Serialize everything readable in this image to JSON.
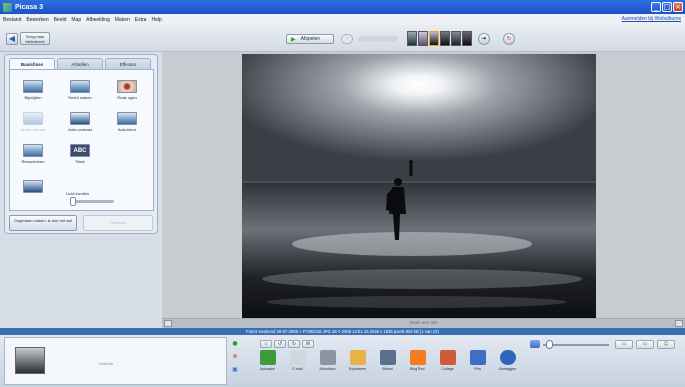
{
  "window": {
    "title": "Picasa 3"
  },
  "menu": {
    "items": [
      "Bestand",
      "Bewerken",
      "Beeld",
      "Map",
      "Afbeelding",
      "Maken",
      "Extra",
      "Help"
    ],
    "signin": "Aanmelden bij Webalbums"
  },
  "toolbar": {
    "back_label": "Terug naar bibliotheek",
    "play_label": "Afspelen"
  },
  "edit_panel": {
    "tabs": [
      "Basisfixes",
      "Afstellen",
      "Effecten"
    ],
    "active_tab": "Basisfixes",
    "tools": [
      {
        "label": "Bijsnijden",
        "icon": "crop-icon",
        "enabled": true
      },
      {
        "label": "Recht maken",
        "icon": "straighten-icon",
        "enabled": true
      },
      {
        "label": "Rode ogen",
        "icon": "red-eye-icon",
        "enabled": true
      },
      {
        "label": "Ik doe het wel",
        "icon": "im-feeling-lucky-icon",
        "enabled": false
      },
      {
        "label": "Auto-contrast",
        "icon": "auto-contrast-icon",
        "enabled": true
      },
      {
        "label": "Auto-kleur",
        "icon": "auto-color-icon",
        "enabled": true
      },
      {
        "label": "Retoucheren",
        "icon": "retouch-icon",
        "enabled": true
      },
      {
        "label": "Tekst",
        "icon": "text-icon",
        "enabled": true
      }
    ],
    "fill_light_label": "Licht invullen",
    "fill_light_value": 0.05,
    "undo_label": "Ongedaan maken: ik doe het wel",
    "redo_label": "Herhalen"
  },
  "viewer": {
    "caption_placeholder": "Maak een titel"
  },
  "info_bar": {
    "text": "Foto's weekend 28-07-2008 > P7280116.JPG    28-7-2008 13:51:15    2048 x 1536 pixels    803 kB    (1 van 22)"
  },
  "tray": {
    "label": "Selectie"
  },
  "actions": [
    {
      "label": "Uploaden",
      "icon": "upload-icon",
      "color": "#3f9a3a"
    },
    {
      "label": "E-mail",
      "icon": "email-icon",
      "color": "#cfd6e0"
    },
    {
      "label": "Afdrukken",
      "icon": "print-icon",
      "color": "#8b95a3"
    },
    {
      "label": "Exporteren",
      "icon": "export-folder-icon",
      "color": "#e9b24a"
    },
    {
      "label": "Winkel",
      "icon": "shop-icon",
      "color": "#5b6f8c"
    },
    {
      "label": "BlogThis!",
      "icon": "blogger-icon",
      "color": "#f47c20"
    },
    {
      "label": "Collage",
      "icon": "collage-icon",
      "color": "#d05b3c"
    },
    {
      "label": "Film",
      "icon": "film-icon",
      "color": "#3d6fc7"
    },
    {
      "label": "Geotaggen",
      "icon": "globe-icon",
      "color": "#2f66b8"
    }
  ],
  "colors": {
    "title_bar": "#2f6fe0",
    "info_bar": "#3b6fb4",
    "accent_orange": "#f2a21b"
  }
}
